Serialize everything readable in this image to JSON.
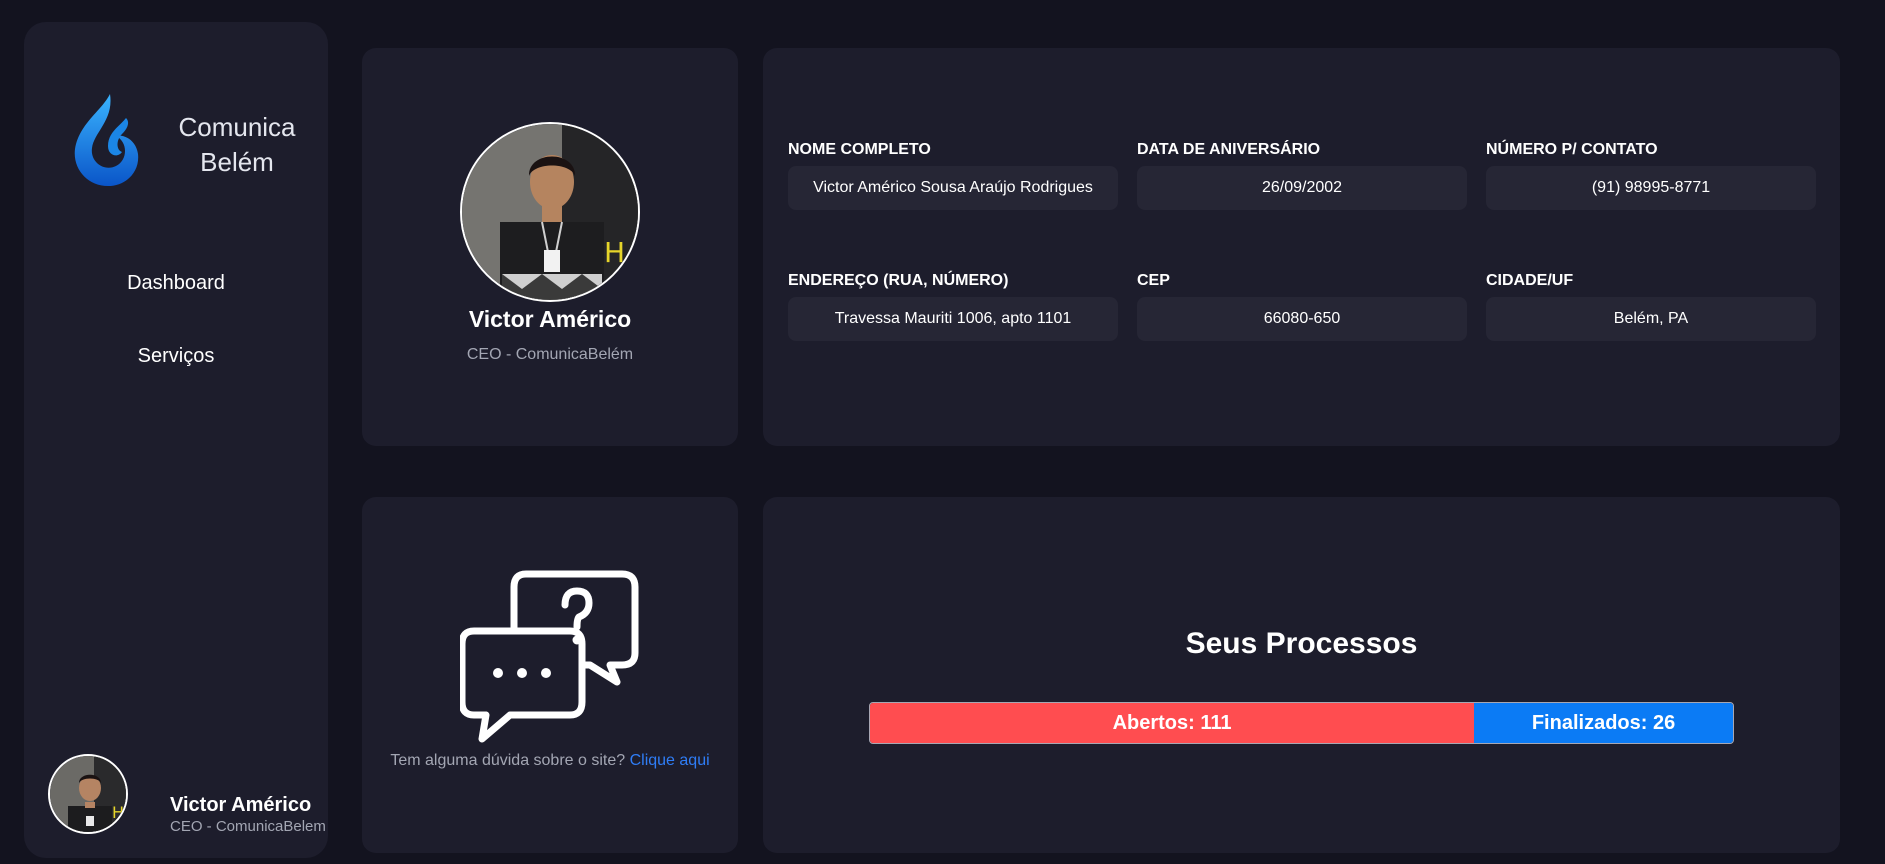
{
  "brand": {
    "line1": "Comunica",
    "line2": "Belém",
    "logo_icon": "water-flame-logo"
  },
  "nav": {
    "items": [
      {
        "label": "Dashboard"
      },
      {
        "label": "Serviços"
      }
    ]
  },
  "sidebar_user": {
    "name": "Victor Américo",
    "role": "CEO - ComunicaBelem"
  },
  "profile": {
    "name": "Victor Américo",
    "role": "CEO - ComunicaBelém"
  },
  "info": {
    "fields": [
      {
        "label": "NOME COMPLETO",
        "value": "Victor Américo Sousa Araújo Rodrigues"
      },
      {
        "label": "DATA DE ANIVERSÁRIO",
        "value": "26/09/2002"
      },
      {
        "label": "NÚMERO P/ CONTATO",
        "value": "(91) 98995-8771"
      },
      {
        "label": "ENDEREÇO (RUA, NÚMERO)",
        "value": "Travessa Mauriti 1006, apto 1101"
      },
      {
        "label": "CEP",
        "value": "66080-650"
      },
      {
        "label": "CIDADE/UF",
        "value": "Belém, PA"
      }
    ]
  },
  "help": {
    "icon": "chat-question-icon",
    "text": "Tem alguma dúvida sobre o site?",
    "link": "Clique aqui"
  },
  "processes": {
    "title": "Seus Processos",
    "open_label": "Abertos: 111",
    "done_label": "Finalizados: 26",
    "open_count": 111,
    "done_count": 26,
    "open_fraction": 0.7,
    "colors": {
      "open": "#ff4d50",
      "done": "#0b7bf5"
    }
  }
}
